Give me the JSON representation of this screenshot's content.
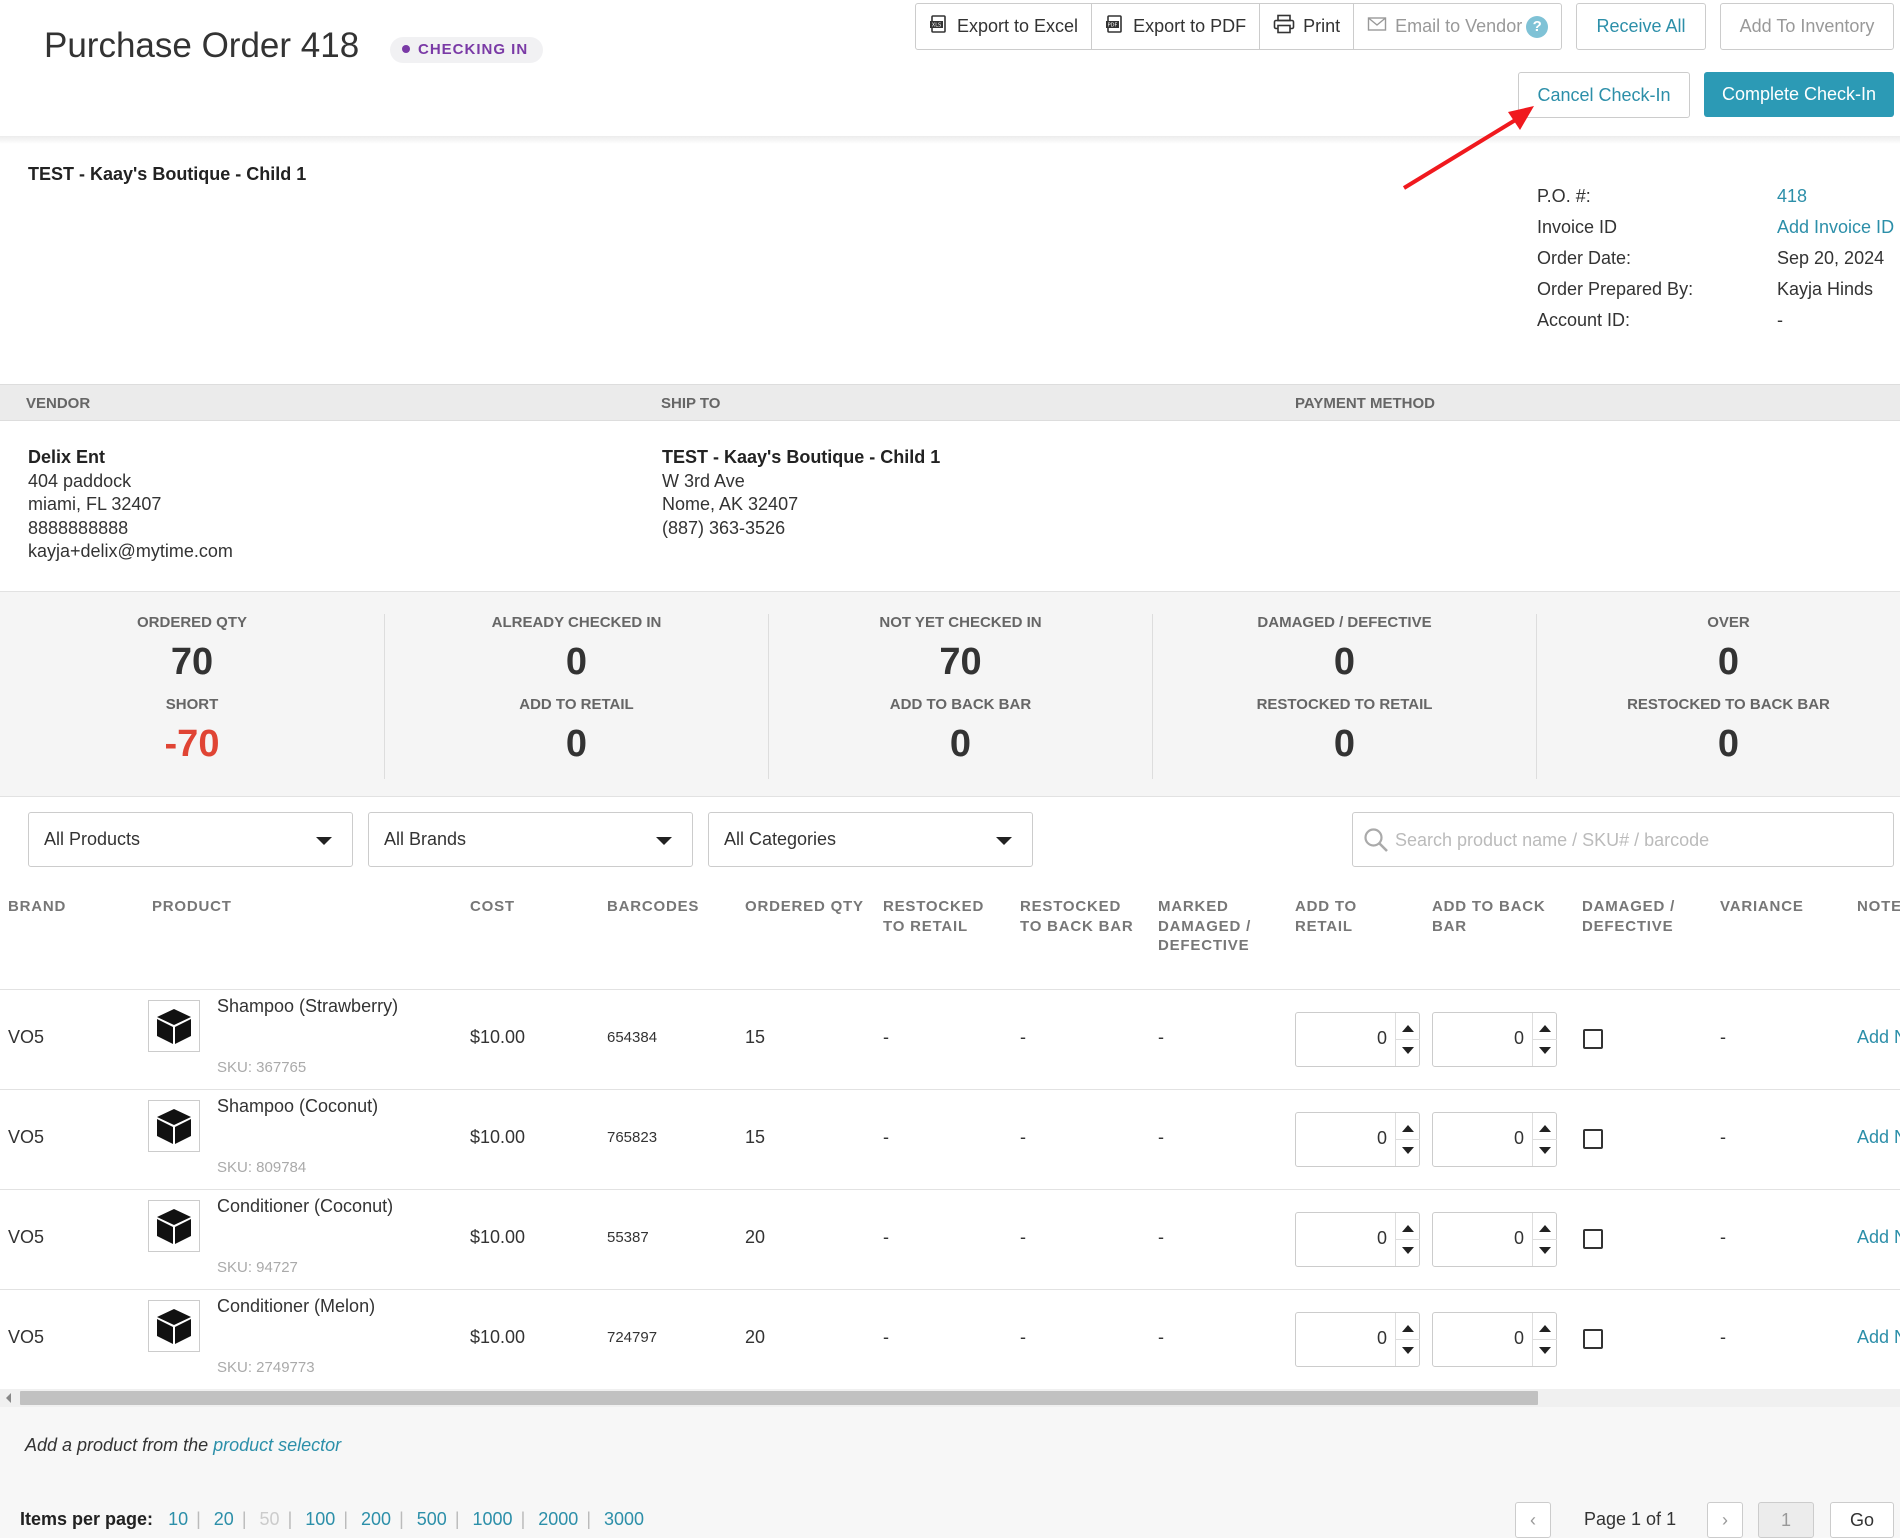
{
  "header": {
    "title": "Purchase Order 418",
    "status": "CHECKING IN",
    "export_excel": "Export to Excel",
    "export_pdf": "Export to PDF",
    "print": "Print",
    "email_vendor": "Email to Vendor",
    "help": "?",
    "receive_all": "Receive All",
    "add_inventory": "Add To Inventory",
    "cancel_checkin": "Cancel Check-In",
    "complete_checkin": "Complete Check-In"
  },
  "store_name": "TEST - Kaay's Boutique - Child 1",
  "po_info": [
    {
      "label": "P.O. #:",
      "value": "418"
    },
    {
      "label": "Invoice ID",
      "value": "Add Invoice ID"
    },
    {
      "label": "Order Date:",
      "value": "Sep 20, 2024"
    },
    {
      "label": "Order Prepared By:",
      "value": "Kayja Hinds"
    },
    {
      "label": "Account ID:",
      "value": "-"
    }
  ],
  "sections": {
    "vendor": "VENDOR",
    "ship_to": "SHIP TO",
    "payment": "PAYMENT METHOD"
  },
  "vendor": {
    "name": "Delix Ent",
    "line1": "404 paddock",
    "line2": "miami, FL 32407",
    "phone": "8888888888",
    "email": "kayja+delix@mytime.com"
  },
  "ship_to": {
    "name": "TEST - Kaay's Boutique - Child 1",
    "line1": "W 3rd Ave",
    "line2": "Nome, AK 32407",
    "phone": "(887) 363-3526"
  },
  "stats": [
    {
      "label1": "ORDERED QTY",
      "val1": "70",
      "label2": "SHORT",
      "val2": "-70"
    },
    {
      "label1": "ALREADY CHECKED IN",
      "val1": "0",
      "label2": "ADD TO RETAIL",
      "val2": "0"
    },
    {
      "label1": "NOT YET CHECKED IN",
      "val1": "70",
      "label2": "ADD TO BACK BAR",
      "val2": "0"
    },
    {
      "label1": "DAMAGED / DEFECTIVE",
      "val1": "0",
      "label2": "RESTOCKED TO RETAIL",
      "val2": "0"
    },
    {
      "label1": "OVER",
      "val1": "0",
      "label2": "RESTOCKED TO BACK BAR",
      "val2": "0"
    }
  ],
  "filters": {
    "products": "All Products",
    "brands": "All Brands",
    "categories": "All Categories",
    "search_placeholder": "Search product name / SKU# / barcode"
  },
  "columns": {
    "brand": "BRAND",
    "product": "PRODUCT",
    "cost": "COST",
    "barcodes": "BARCODES",
    "ordered_qty": "ORDERED QTY",
    "restocked_retail_1": "RESTOCKED",
    "restocked_retail_2": "TO RETAIL",
    "restocked_back_1": "RESTOCKED",
    "restocked_back_2": "TO BACK BAR",
    "marked_1": "MARKED",
    "marked_2": "DAMAGED /",
    "marked_3": "DEFECTIVE",
    "add_retail_1": "ADD TO",
    "add_retail_2": "RETAIL",
    "add_back_1": "ADD TO BACK",
    "add_back_2": "BAR",
    "damaged_1": "DAMAGED /",
    "damaged_2": "DEFECTIVE",
    "variance": "VARIANCE",
    "notes": "NOTE"
  },
  "rows": [
    {
      "brand": "VO5",
      "product": "Shampoo (Strawberry)",
      "sku": "SKU: 367765",
      "cost": "$10.00",
      "barcode": "654384",
      "ordered": "15",
      "rr": "-",
      "rb": "-",
      "md": "-",
      "add_retail": "0",
      "add_back": "0",
      "variance": "-",
      "notes": "Add N"
    },
    {
      "brand": "VO5",
      "product": "Shampoo (Coconut)",
      "sku": "SKU: 809784",
      "cost": "$10.00",
      "barcode": "765823",
      "ordered": "15",
      "rr": "-",
      "rb": "-",
      "md": "-",
      "add_retail": "0",
      "add_back": "0",
      "variance": "-",
      "notes": "Add N"
    },
    {
      "brand": "VO5",
      "product": "Conditioner (Coconut)",
      "sku": "SKU: 94727",
      "cost": "$10.00",
      "barcode": "55387",
      "ordered": "20",
      "rr": "-",
      "rb": "-",
      "md": "-",
      "add_retail": "0",
      "add_back": "0",
      "variance": "-",
      "notes": "Add N"
    },
    {
      "brand": "VO5",
      "product": "Conditioner (Melon)",
      "sku": "SKU: 2749773",
      "cost": "$10.00",
      "barcode": "724797",
      "ordered": "20",
      "rr": "-",
      "rb": "-",
      "md": "-",
      "add_retail": "0",
      "add_back": "0",
      "variance": "-",
      "notes": "Add N"
    }
  ],
  "footer": {
    "add_product_prefix": "Add a product from the ",
    "add_product_link": "product selector",
    "items_per_page": "Items per page:",
    "page_sizes": [
      "10",
      "20",
      "50",
      "100",
      "200",
      "500",
      "1000",
      "2000",
      "3000"
    ],
    "page_label": "Page 1 of 1",
    "page_input": "1",
    "go": "Go",
    "prev": "‹",
    "next": "›"
  },
  "colors": {
    "accent": "#2c9ab5",
    "link": "#2c8fa9",
    "status": "#7a3aa6",
    "negative": "#e04434",
    "arrow": "#f0191e"
  }
}
